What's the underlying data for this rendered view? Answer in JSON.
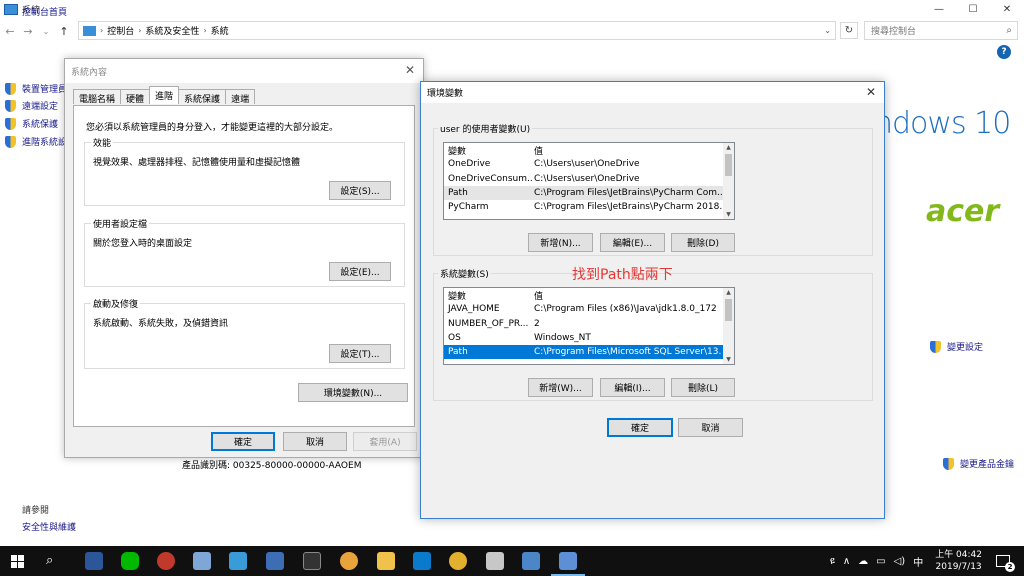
{
  "window": {
    "title": "系統",
    "controls": [
      "—",
      "☐",
      "✕"
    ]
  },
  "address": {
    "crumbs": [
      "控制台",
      "系統及安全性",
      "系統"
    ],
    "search_placeholder": "搜尋控制台"
  },
  "sidebar": {
    "home": "控制台首頁",
    "items": [
      {
        "label": "裝置管理員"
      },
      {
        "label": "遠端設定"
      },
      {
        "label": "系統保護"
      },
      {
        "label": "進階系統設定"
      }
    ],
    "see_also": "請參閱",
    "security_link": "安全性與維護"
  },
  "brand": {
    "windows": "ndows 10",
    "oem": "acer"
  },
  "main_links": {
    "change_settings": "變更設定",
    "change_product_key": "變更產品金鑰"
  },
  "product_id": "產品識別碼: 00325-80000-00000-AAOEM",
  "sysprop": {
    "title": "系統內容",
    "tabs": [
      "電腦名稱",
      "硬體",
      "進階",
      "系統保護",
      "遠端"
    ],
    "active_tab": "進階",
    "note": "您必須以系統管理員的身分登入，才能變更這裡的大部分設定。",
    "groups": [
      {
        "title": "效能",
        "desc": "視覺效果、處理器排程、記憶體使用量和虛擬記憶體",
        "button": "設定(S)..."
      },
      {
        "title": "使用者設定檔",
        "desc": "關於您登入時的桌面設定",
        "button": "設定(E)..."
      },
      {
        "title": "啟動及修復",
        "desc": "系統啟動、系統失敗，及偵錯資訊",
        "button": "設定(T)..."
      }
    ],
    "env_button": "環境變數(N)...",
    "ok": "確定",
    "cancel": "取消",
    "apply": "套用(A)"
  },
  "envvar": {
    "title": "環境變數",
    "user_group": "user 的使用者變數(U)",
    "system_group": "系統變數(S)",
    "col_var": "變數",
    "col_val": "值",
    "user_vars": [
      {
        "name": "OneDrive",
        "value": "C:\\Users\\user\\OneDrive"
      },
      {
        "name": "OneDriveConsum...",
        "value": "C:\\Users\\user\\OneDrive"
      },
      {
        "name": "Path",
        "value": "C:\\Program Files\\JetBrains\\PyCharm Com..."
      },
      {
        "name": "PyCharm",
        "value": "C:\\Program Files\\JetBrains\\PyCharm 2018..."
      }
    ],
    "system_vars": [
      {
        "name": "JAVA_HOME",
        "value": "C:\\Program Files (x86)\\Java\\jdk1.8.0_172"
      },
      {
        "name": "NUMBER_OF_PR...",
        "value": "2"
      },
      {
        "name": "OS",
        "value": "Windows_NT"
      },
      {
        "name": "Path",
        "value": "C:\\Program Files\\Microsoft SQL Server\\13..."
      }
    ],
    "new": "新增(N)...",
    "edit": "編輯(E)...",
    "delete": "刪除(D)",
    "new_sys": "新增(W)...",
    "edit_sys": "編輯(I)...",
    "delete_sys": "刪除(L)",
    "ok": "確定",
    "cancel": "取消",
    "annotation": "找到Path點兩下"
  },
  "taskbar": {
    "clock_time": "上午 04:42",
    "clock_date": "2019/7/13",
    "notifications": "2",
    "tray_lang": "中",
    "colors": {
      "bg": "#101010",
      "accent": "#76b9ed"
    }
  }
}
